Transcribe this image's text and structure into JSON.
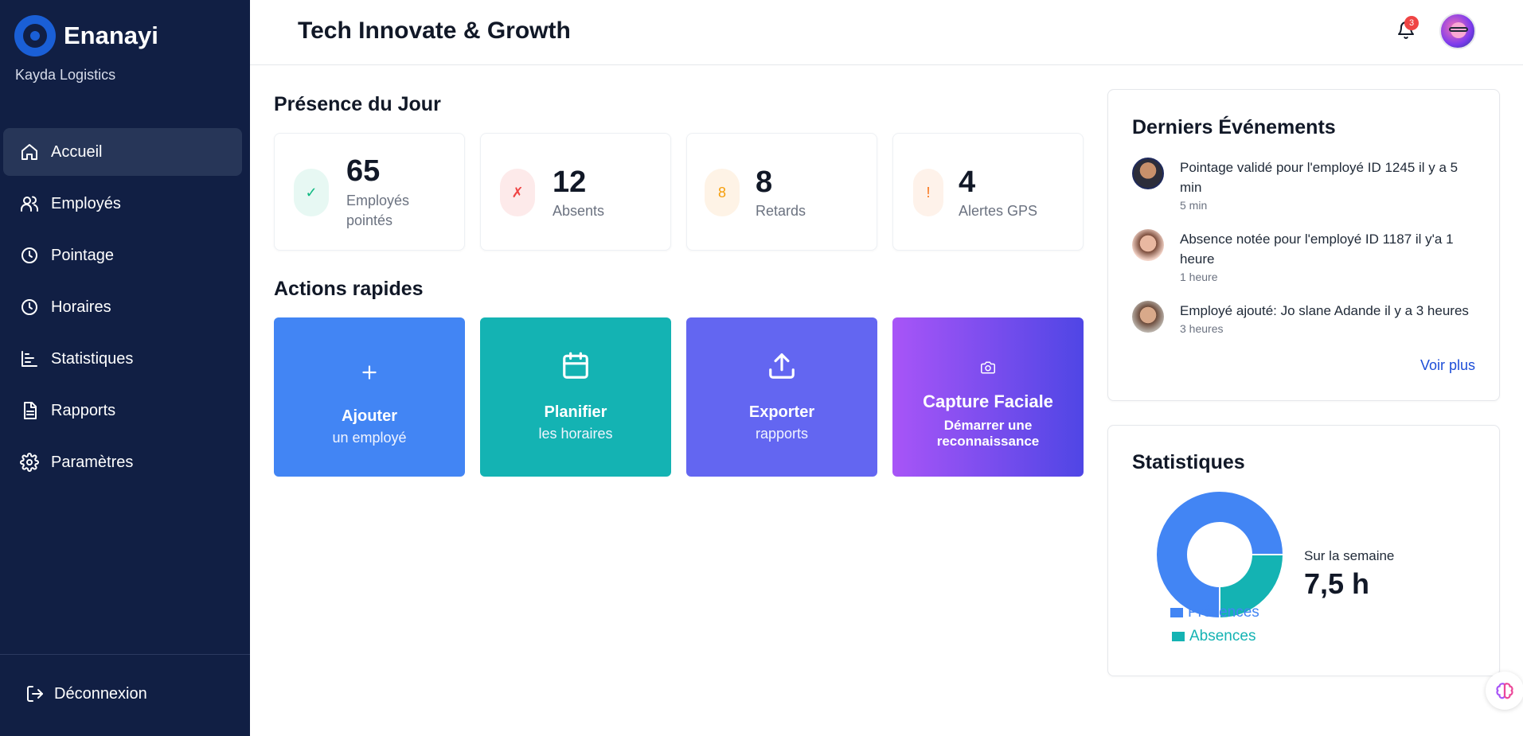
{
  "brand": {
    "name": "Enanayi",
    "company": "Kayda Logistics"
  },
  "sidebar": {
    "items": [
      {
        "label": "Accueil",
        "icon": "home-icon",
        "active": true
      },
      {
        "label": "Employés",
        "icon": "users-icon"
      },
      {
        "label": "Pointage",
        "icon": "clock-icon"
      },
      {
        "label": "Horaires",
        "icon": "clock-icon"
      },
      {
        "label": "Statistiques",
        "icon": "bar-chart-icon"
      },
      {
        "label": "Rapports",
        "icon": "file-icon"
      },
      {
        "label": "Paramètres",
        "icon": "gear-icon"
      }
    ],
    "logout_label": "Déconnexion"
  },
  "header": {
    "title": "Tech Innovate & Growth",
    "notification_count": "3"
  },
  "presence": {
    "title": "Présence du Jour",
    "cards": [
      {
        "icon": "✓",
        "value": "65",
        "label": "Employés pointés",
        "color": "#10b981",
        "bg": "#e7f8f3"
      },
      {
        "icon": "✗",
        "value": "12",
        "label": "Absents",
        "color": "#ef4444",
        "bg": "#fdeaea"
      },
      {
        "icon": "8",
        "value": "8",
        "label": "Retards",
        "color": "#f59e0b",
        "bg": "#fef3e6"
      },
      {
        "icon": "!",
        "value": "4",
        "label": "Alertes GPS",
        "color": "#f97316",
        "bg": "#fef2ea"
      }
    ]
  },
  "actions": {
    "title": "Actions rapides",
    "cards": [
      {
        "title": "Ajouter",
        "sub": "un employé",
        "icon": "plus-icon",
        "color": "#4285f4"
      },
      {
        "title": "Planifier",
        "sub": "les horaires",
        "icon": "calendar-icon",
        "color": "#14b3b3"
      },
      {
        "title": "Exporter",
        "sub": "rapports",
        "icon": "upload-icon",
        "color": "#6366f1"
      },
      {
        "title": "Capture Faciale",
        "sub": "Démarrer une reconnaissance",
        "icon": "camera-icon",
        "color": "#a855f7"
      }
    ]
  },
  "events": {
    "title": "Derniers Événements",
    "items": [
      {
        "text": "Pointage validé pour l'employé ID 1245 il y a 5 min",
        "time": "5 min"
      },
      {
        "text": "Absence notée pour l'employé ID 1187 il y'a 1 heure",
        "time": "1 heure"
      },
      {
        "text": "Employé ajouté: Jo slane Adande il y a 3 heures",
        "time": "3 heures"
      }
    ],
    "more_label": "Voir plus"
  },
  "stats": {
    "title": "Statistiques",
    "period_label": "Sur la semaine",
    "hours": "7,5 h"
  },
  "chart_data": {
    "type": "pie",
    "categories": [
      "Présences",
      "Absences"
    ],
    "values": [
      75,
      25
    ],
    "colors": [
      "#4285f4",
      "#14b3b3"
    ],
    "donut": true,
    "legend": "bottom"
  }
}
